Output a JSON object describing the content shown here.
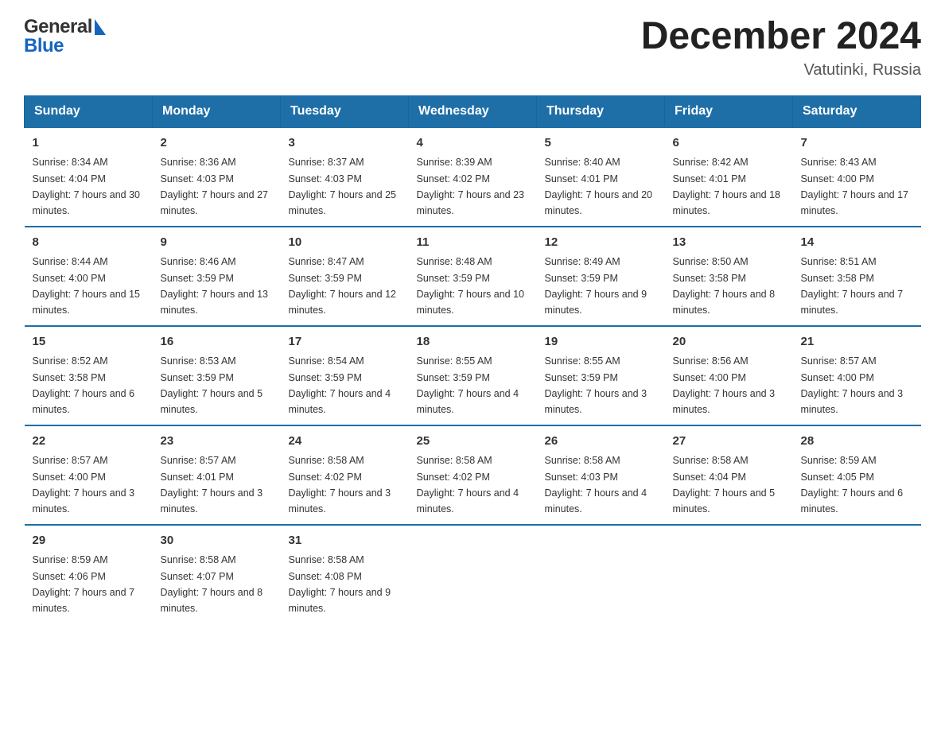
{
  "header": {
    "logo_line1": "General",
    "logo_line2": "Blue",
    "month_title": "December 2024",
    "location": "Vatutinki, Russia"
  },
  "days_of_week": [
    "Sunday",
    "Monday",
    "Tuesday",
    "Wednesday",
    "Thursday",
    "Friday",
    "Saturday"
  ],
  "weeks": [
    [
      {
        "day": "1",
        "sunrise": "Sunrise: 8:34 AM",
        "sunset": "Sunset: 4:04 PM",
        "daylight": "Daylight: 7 hours and 30 minutes."
      },
      {
        "day": "2",
        "sunrise": "Sunrise: 8:36 AM",
        "sunset": "Sunset: 4:03 PM",
        "daylight": "Daylight: 7 hours and 27 minutes."
      },
      {
        "day": "3",
        "sunrise": "Sunrise: 8:37 AM",
        "sunset": "Sunset: 4:03 PM",
        "daylight": "Daylight: 7 hours and 25 minutes."
      },
      {
        "day": "4",
        "sunrise": "Sunrise: 8:39 AM",
        "sunset": "Sunset: 4:02 PM",
        "daylight": "Daylight: 7 hours and 23 minutes."
      },
      {
        "day": "5",
        "sunrise": "Sunrise: 8:40 AM",
        "sunset": "Sunset: 4:01 PM",
        "daylight": "Daylight: 7 hours and 20 minutes."
      },
      {
        "day": "6",
        "sunrise": "Sunrise: 8:42 AM",
        "sunset": "Sunset: 4:01 PM",
        "daylight": "Daylight: 7 hours and 18 minutes."
      },
      {
        "day": "7",
        "sunrise": "Sunrise: 8:43 AM",
        "sunset": "Sunset: 4:00 PM",
        "daylight": "Daylight: 7 hours and 17 minutes."
      }
    ],
    [
      {
        "day": "8",
        "sunrise": "Sunrise: 8:44 AM",
        "sunset": "Sunset: 4:00 PM",
        "daylight": "Daylight: 7 hours and 15 minutes."
      },
      {
        "day": "9",
        "sunrise": "Sunrise: 8:46 AM",
        "sunset": "Sunset: 3:59 PM",
        "daylight": "Daylight: 7 hours and 13 minutes."
      },
      {
        "day": "10",
        "sunrise": "Sunrise: 8:47 AM",
        "sunset": "Sunset: 3:59 PM",
        "daylight": "Daylight: 7 hours and 12 minutes."
      },
      {
        "day": "11",
        "sunrise": "Sunrise: 8:48 AM",
        "sunset": "Sunset: 3:59 PM",
        "daylight": "Daylight: 7 hours and 10 minutes."
      },
      {
        "day": "12",
        "sunrise": "Sunrise: 8:49 AM",
        "sunset": "Sunset: 3:59 PM",
        "daylight": "Daylight: 7 hours and 9 minutes."
      },
      {
        "day": "13",
        "sunrise": "Sunrise: 8:50 AM",
        "sunset": "Sunset: 3:58 PM",
        "daylight": "Daylight: 7 hours and 8 minutes."
      },
      {
        "day": "14",
        "sunrise": "Sunrise: 8:51 AM",
        "sunset": "Sunset: 3:58 PM",
        "daylight": "Daylight: 7 hours and 7 minutes."
      }
    ],
    [
      {
        "day": "15",
        "sunrise": "Sunrise: 8:52 AM",
        "sunset": "Sunset: 3:58 PM",
        "daylight": "Daylight: 7 hours and 6 minutes."
      },
      {
        "day": "16",
        "sunrise": "Sunrise: 8:53 AM",
        "sunset": "Sunset: 3:59 PM",
        "daylight": "Daylight: 7 hours and 5 minutes."
      },
      {
        "day": "17",
        "sunrise": "Sunrise: 8:54 AM",
        "sunset": "Sunset: 3:59 PM",
        "daylight": "Daylight: 7 hours and 4 minutes."
      },
      {
        "day": "18",
        "sunrise": "Sunrise: 8:55 AM",
        "sunset": "Sunset: 3:59 PM",
        "daylight": "Daylight: 7 hours and 4 minutes."
      },
      {
        "day": "19",
        "sunrise": "Sunrise: 8:55 AM",
        "sunset": "Sunset: 3:59 PM",
        "daylight": "Daylight: 7 hours and 3 minutes."
      },
      {
        "day": "20",
        "sunrise": "Sunrise: 8:56 AM",
        "sunset": "Sunset: 4:00 PM",
        "daylight": "Daylight: 7 hours and 3 minutes."
      },
      {
        "day": "21",
        "sunrise": "Sunrise: 8:57 AM",
        "sunset": "Sunset: 4:00 PM",
        "daylight": "Daylight: 7 hours and 3 minutes."
      }
    ],
    [
      {
        "day": "22",
        "sunrise": "Sunrise: 8:57 AM",
        "sunset": "Sunset: 4:00 PM",
        "daylight": "Daylight: 7 hours and 3 minutes."
      },
      {
        "day": "23",
        "sunrise": "Sunrise: 8:57 AM",
        "sunset": "Sunset: 4:01 PM",
        "daylight": "Daylight: 7 hours and 3 minutes."
      },
      {
        "day": "24",
        "sunrise": "Sunrise: 8:58 AM",
        "sunset": "Sunset: 4:02 PM",
        "daylight": "Daylight: 7 hours and 3 minutes."
      },
      {
        "day": "25",
        "sunrise": "Sunrise: 8:58 AM",
        "sunset": "Sunset: 4:02 PM",
        "daylight": "Daylight: 7 hours and 4 minutes."
      },
      {
        "day": "26",
        "sunrise": "Sunrise: 8:58 AM",
        "sunset": "Sunset: 4:03 PM",
        "daylight": "Daylight: 7 hours and 4 minutes."
      },
      {
        "day": "27",
        "sunrise": "Sunrise: 8:58 AM",
        "sunset": "Sunset: 4:04 PM",
        "daylight": "Daylight: 7 hours and 5 minutes."
      },
      {
        "day": "28",
        "sunrise": "Sunrise: 8:59 AM",
        "sunset": "Sunset: 4:05 PM",
        "daylight": "Daylight: 7 hours and 6 minutes."
      }
    ],
    [
      {
        "day": "29",
        "sunrise": "Sunrise: 8:59 AM",
        "sunset": "Sunset: 4:06 PM",
        "daylight": "Daylight: 7 hours and 7 minutes."
      },
      {
        "day": "30",
        "sunrise": "Sunrise: 8:58 AM",
        "sunset": "Sunset: 4:07 PM",
        "daylight": "Daylight: 7 hours and 8 minutes."
      },
      {
        "day": "31",
        "sunrise": "Sunrise: 8:58 AM",
        "sunset": "Sunset: 4:08 PM",
        "daylight": "Daylight: 7 hours and 9 minutes."
      },
      {
        "day": "",
        "sunrise": "",
        "sunset": "",
        "daylight": ""
      },
      {
        "day": "",
        "sunrise": "",
        "sunset": "",
        "daylight": ""
      },
      {
        "day": "",
        "sunrise": "",
        "sunset": "",
        "daylight": ""
      },
      {
        "day": "",
        "sunrise": "",
        "sunset": "",
        "daylight": ""
      }
    ]
  ]
}
